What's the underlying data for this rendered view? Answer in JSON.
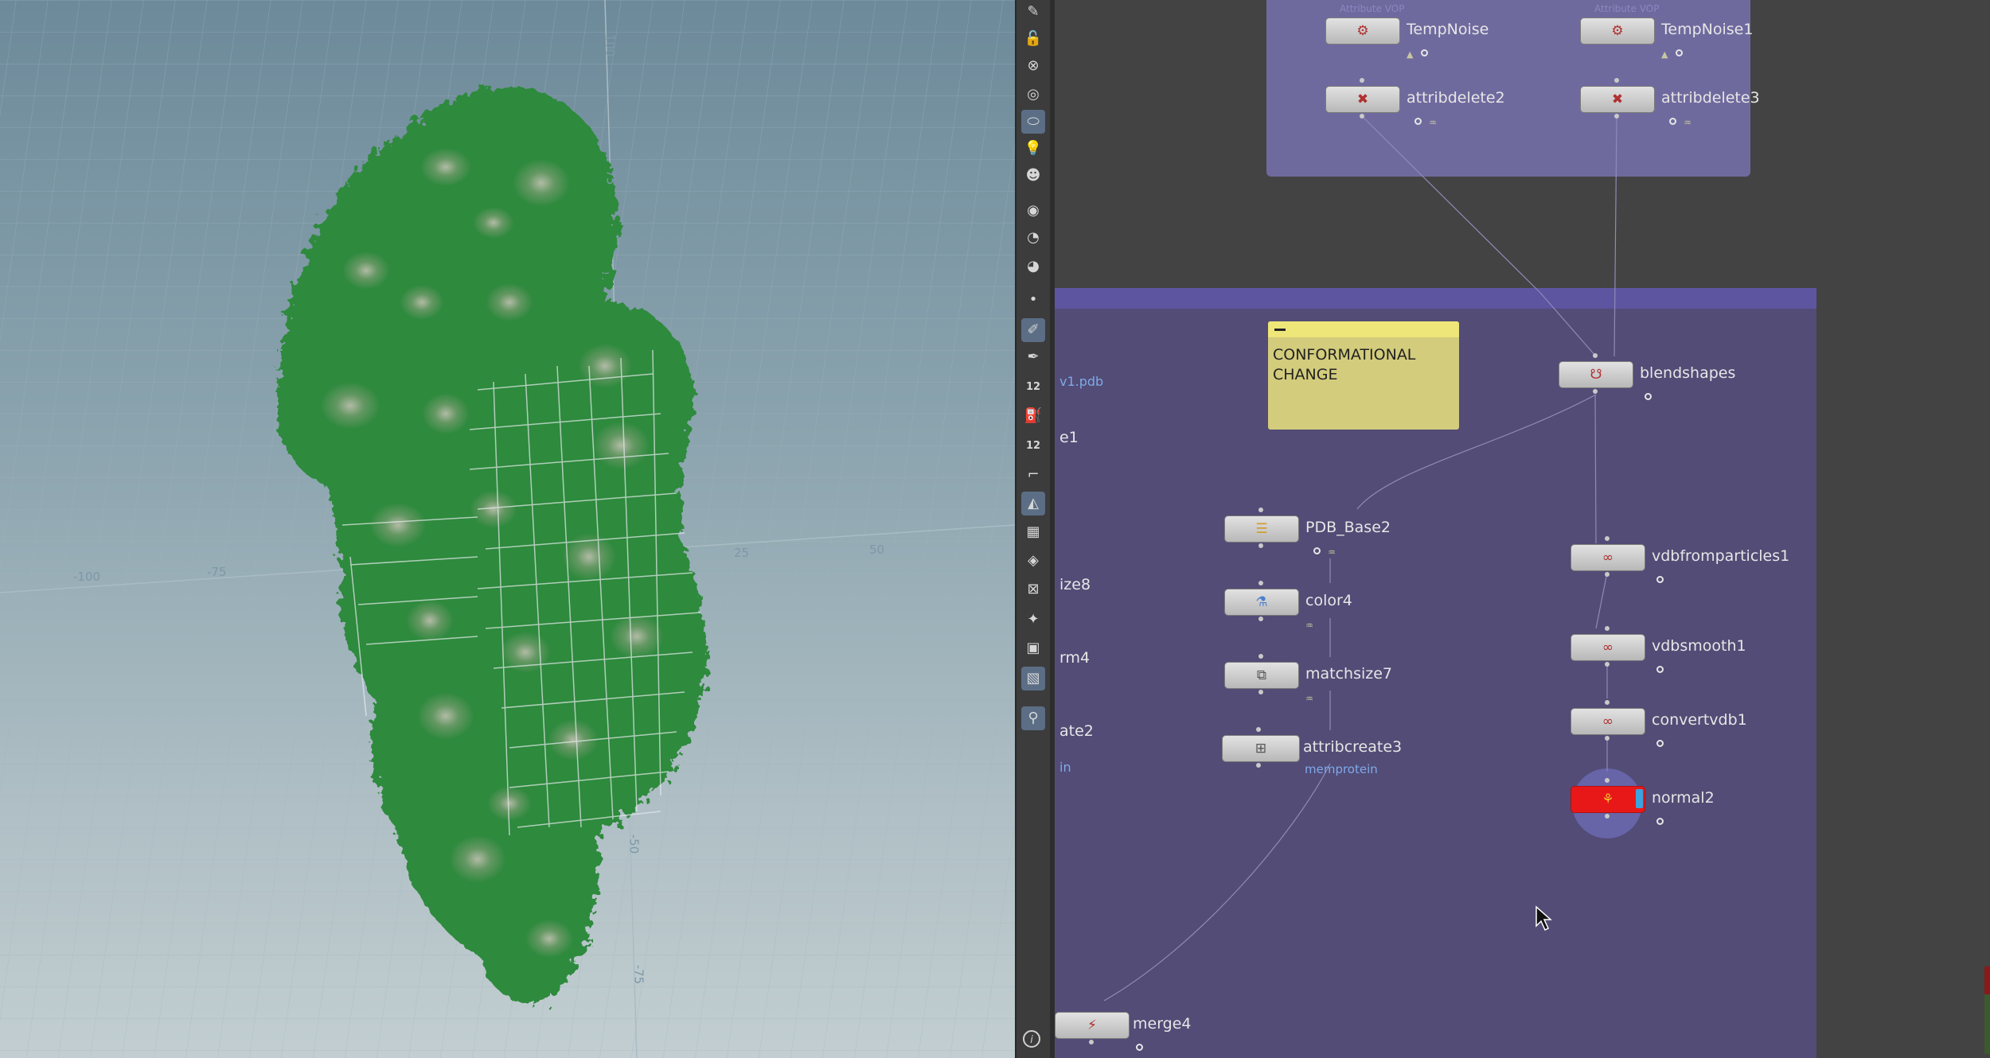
{
  "viewport": {
    "axis_labels": [
      "100",
      "75",
      "-100",
      "-75",
      "25",
      "50",
      "-50",
      "-75"
    ]
  },
  "shelf": {
    "tools": [
      {
        "icon": "pose-icon"
      },
      {
        "icon": "lock-icon"
      },
      {
        "icon": "no-symbol-icon"
      },
      {
        "icon": "camera-lens-icon"
      },
      {
        "icon": "light-icon",
        "active": true
      },
      {
        "icon": "bulb-icon"
      },
      {
        "icon": "skull-light-icon"
      },
      {
        "icon": "render-icon"
      },
      {
        "icon": "eye-icon"
      },
      {
        "icon": "eye-camera-icon"
      },
      {
        "icon": "point-icon"
      },
      {
        "icon": "brush-icon",
        "active": true
      },
      {
        "icon": "pen-icon"
      },
      {
        "icon": "number-icon",
        "text": "12"
      },
      {
        "icon": "bucket-icon"
      },
      {
        "icon": "number-bucket-icon",
        "text": "12"
      },
      {
        "icon": "curve-icon"
      },
      {
        "icon": "sculpt-icon",
        "active": true
      },
      {
        "icon": "checker-icon"
      },
      {
        "icon": "diamond-icon"
      },
      {
        "icon": "uv-icon"
      },
      {
        "icon": "bone-icon"
      },
      {
        "icon": "grid-icon"
      },
      {
        "icon": "image-icon",
        "active": true
      },
      {
        "icon": "pin-icon",
        "active": true
      }
    ],
    "info": "i"
  },
  "network": {
    "sticky_note": {
      "text_line1": "CONFORMATIONAL",
      "text_line2": "CHANGE"
    },
    "edge_labels": {
      "pdb": "v1.pdb",
      "e1": "e1",
      "size8": "ize8",
      "rm4": "rm4",
      "ate2": "ate2",
      "in": "in"
    },
    "nodes": {
      "tempnoise": {
        "name": "TempNoise",
        "caption": "Attribute VOP"
      },
      "tempnoise1": {
        "name": "TempNoise1",
        "caption": "Attribute VOP"
      },
      "attribdelete2": {
        "name": "attribdelete2"
      },
      "attribdelete3": {
        "name": "attribdelete3"
      },
      "blendshapes": {
        "name": "blendshapes"
      },
      "pdb_base2": {
        "name": "PDB_Base2"
      },
      "color4": {
        "name": "color4"
      },
      "matchsize7": {
        "name": "matchsize7"
      },
      "attribcreate3": {
        "name": "attribcreate3",
        "sub": "memprotein"
      },
      "vdbfromparticles1": {
        "name": "vdbfromparticles1"
      },
      "vdbsmooth1": {
        "name": "vdbsmooth1"
      },
      "convertvdb1": {
        "name": "convertvdb1"
      },
      "normal2": {
        "name": "normal2"
      },
      "merge4": {
        "name": "merge4"
      }
    },
    "colors": {
      "top_box": "#6f6a9e",
      "main_box": "#524c76",
      "sticky": "#d3cc7c",
      "display_flag": "#e91818",
      "template_flag": "#3aa4e0"
    }
  }
}
